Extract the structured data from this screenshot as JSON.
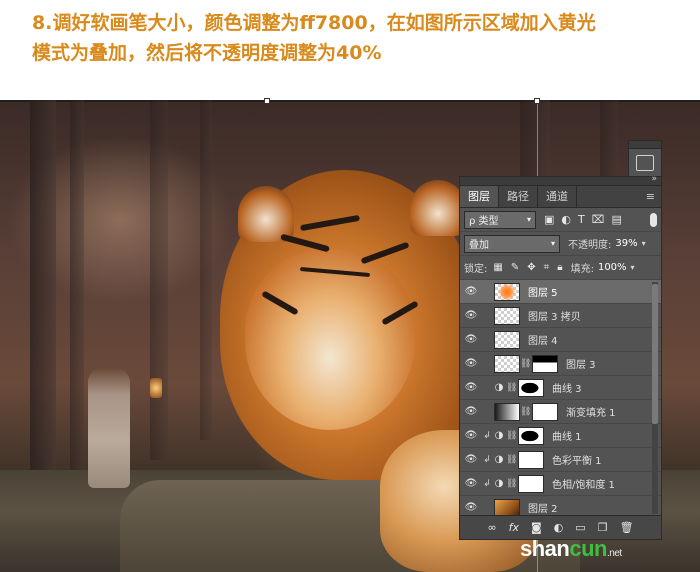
{
  "instruction": {
    "line1": "8.调好软画笔大小，颜色调整为ff7800，在如图所示区域加入黄光",
    "line2": "模式为叠加，然后将不透明度调整为40%"
  },
  "colors": {
    "instruction_text": "#d98a1c",
    "brush_color": "#ff7800",
    "panel_bg": "#535353",
    "selected_row": "#6b6b6b"
  },
  "layers_panel": {
    "tabs": [
      {
        "label": "图层",
        "active": true
      },
      {
        "label": "路径",
        "active": false
      },
      {
        "label": "通道",
        "active": false
      }
    ],
    "filter": {
      "kind_label": "ρ 类型"
    },
    "blend_mode": "叠加",
    "opacity_label": "不透明度:",
    "opacity_value": "39%",
    "lock_label": "锁定:",
    "fill_label": "填充:",
    "fill_value": "100%",
    "layers": [
      {
        "name": "图层 5",
        "selected": true
      },
      {
        "name": "图层 3 拷贝",
        "selected": false
      },
      {
        "name": "图层 4",
        "selected": false
      },
      {
        "name": "图层 3",
        "selected": false
      },
      {
        "name": "曲线 3",
        "selected": false
      },
      {
        "name": "渐变填充 1",
        "selected": false
      },
      {
        "name": "曲线 1",
        "selected": false
      },
      {
        "name": "色彩平衡 1",
        "selected": false
      },
      {
        "name": "色相/饱和度 1",
        "selected": false
      },
      {
        "name": "图层 2",
        "selected": false
      }
    ],
    "bottom_icons": [
      "link-icon",
      "fx-icon",
      "mask-icon",
      "adjustment-icon",
      "group-icon",
      "new-layer-icon",
      "trash-icon"
    ]
  },
  "watermark": {
    "text_white": "shan",
    "text_green": "cun",
    "suffix": ".net"
  }
}
